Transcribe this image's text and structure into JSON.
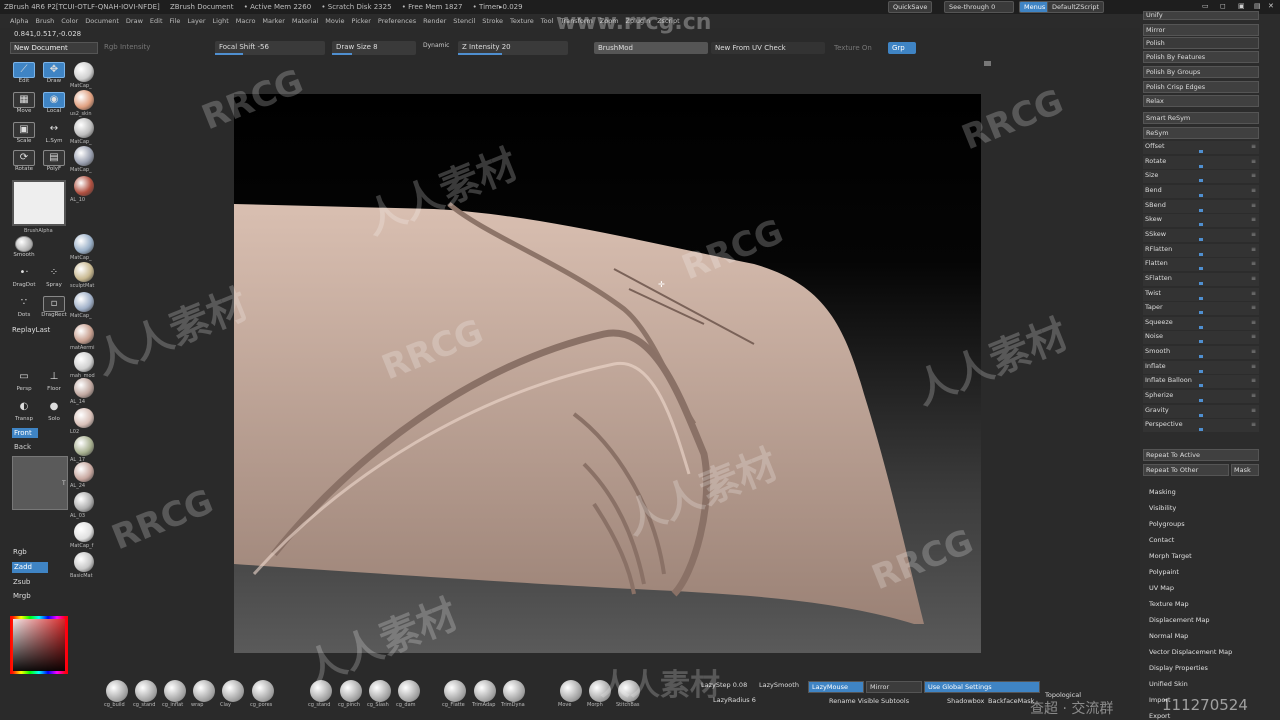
{
  "titlebar": {
    "app": "ZBrush 4R6 P2[TCUI-OTLF-QNAH-IOVI-NFDE]",
    "doc": "ZBrush Document",
    "active_mem": "• Active Mem 2260",
    "scratch": "• Scratch Disk 2325",
    "free_mem": "• Free Mem 1827",
    "timer": "• Timer▸0.029",
    "quicksave": "QuickSave",
    "seethrough": "See-through  0",
    "menus": "Menus",
    "script": "DefaultZScript"
  },
  "menus": [
    "Alpha",
    "Brush",
    "Color",
    "Document",
    "Draw",
    "Edit",
    "File",
    "Layer",
    "Light",
    "Macro",
    "Marker",
    "Material",
    "Movie",
    "Picker",
    "Preferences",
    "Render",
    "Stencil",
    "Stroke",
    "Texture",
    "Tool",
    "Transform",
    "Zoom",
    "Zplugin",
    "Zscript"
  ],
  "coords": "0.841,0.517,-0.028",
  "new_document": "New Document",
  "topbar": {
    "rgb_intensity": "Rgb Intensity",
    "focal_shift": "Focal Shift -56",
    "draw_size": "Draw Size 8",
    "dynamic": "Dynamic",
    "z_intensity": "Z Intensity 20",
    "brushmod": "BrushMod",
    "new_from_uv": "New From UV Check",
    "texture_on": "Texture On",
    "grp": "Grp"
  },
  "tools": {
    "edit": "Edit",
    "draw": "Draw",
    "move": "Move",
    "local": "Local",
    "scale": "Scale",
    "lsym": "L.Sym",
    "rotate": "Rotate",
    "polyf": "PolyF",
    "smooth": "Smooth",
    "dragdot": "DragDot",
    "spray": "Spray",
    "dots": "Dots",
    "dragrect": "DragRect",
    "brush_alpha": "BrushAlpha",
    "perp": "Persp",
    "floor": "Floor",
    "dynamic": "Dynamic",
    "transp": "Transp",
    "solo": "Solo"
  },
  "materials": [
    "MatCap_",
    "us2_skin",
    "MatCap_",
    "MatCap_",
    "AL_10",
    "MatCap_",
    "sculptMat",
    "MatCap_",
    "matAermi",
    "mah_mod",
    "AL_14",
    "L02",
    "AL_17",
    "AL_24",
    "AL_03",
    "MatCap_f",
    "BasicMat"
  ],
  "replay_last": "ReplayLast",
  "front": "Front",
  "back": "Back",
  "t_label": "T",
  "modes": {
    "rgb": "Rgb",
    "zadd": "Zadd",
    "zsub": "Zsub",
    "mrgb": "Mrgb"
  },
  "deformation": {
    "top": "Unify",
    "mirror": "Mirror",
    "polish": "Polish",
    "polish_features": "Polish By Features",
    "polish_groups": "Polish By Groups",
    "polish_crisp": "Polish Crisp Edges",
    "relax": "Relax",
    "smart_resym": "Smart ReSym",
    "resym": "ReSym",
    "sliders": [
      "Offset",
      "Rotate",
      "Size",
      "Bend",
      "SBend",
      "Skew",
      "SSkew",
      "RFlatten",
      "Flatten",
      "SFlatten",
      "Twist",
      "Taper",
      "Squeeze",
      "Noise",
      "Smooth",
      "Inflate",
      "Inflate Balloon",
      "Spherize",
      "Gravity",
      "Perspective"
    ],
    "repeat_active": "Repeat To Active",
    "repeat_other": "Repeat To Other",
    "mask": "Mask"
  },
  "subpalettes": [
    "Masking",
    "Visibility",
    "Polygroups",
    "Contact",
    "Morph Target",
    "Polypaint",
    "UV Map",
    "Texture Map",
    "Displacement Map",
    "Normal Map",
    "Vector Displacement Map",
    "Display Properties",
    "Unified Skin",
    "Import",
    "Export"
  ],
  "brushes": [
    "cg_build",
    "cg_stand",
    "cg_inflat",
    "wrap",
    "Clay",
    "cg_pores",
    "cg_stand",
    "cg_pinch",
    "cg_Slash",
    "cg_dam",
    "cg_Flatte",
    "TrimAdap",
    "TrimDyna",
    "Move",
    "Morph",
    "StitchBas"
  ],
  "bottom": {
    "lazystep": "LazyStep 0.08",
    "lazysmooth": "LazySmooth",
    "lazymouse": "LazyMouse",
    "lazyradius": "LazyRadius 6",
    "mirror": "Mirror",
    "use_global": "Use Global Settings",
    "rename": "Rename Visible Subtools",
    "shadowbox": "Shadowbox",
    "backfacemask": "BackfaceMask",
    "topological": "Topological"
  },
  "watermarks": {
    "url": "www.rrcg.cn",
    "rrcg": "RRCG",
    "cn": "人人素材",
    "footer_cn": "查超 · 交流群",
    "footer_num": "111270524"
  },
  "colors": {
    "accent": "#3f84c4",
    "clay": "#c8aa9c"
  }
}
